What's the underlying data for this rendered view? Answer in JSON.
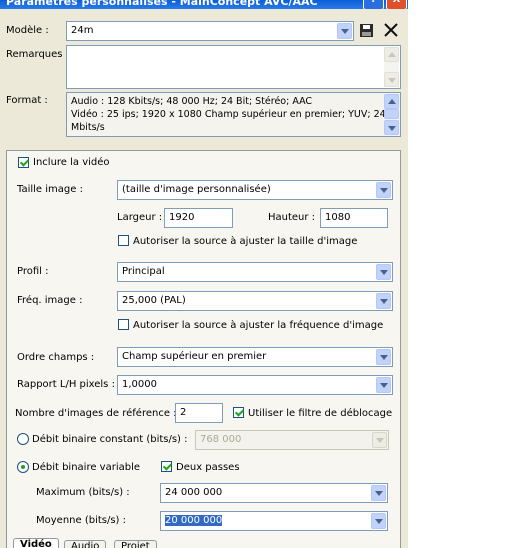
{
  "window": {
    "title": "Paramètres personnalisés - MainConcept AVC/AAC",
    "help_button": "?",
    "close_button": "X"
  },
  "modele": {
    "label": "Modèle :",
    "value": "24m"
  },
  "remarques": {
    "label": "Remarques :",
    "value": ""
  },
  "format": {
    "label": "Format :",
    "line1": "Audio : 128 Kbits/s; 48 000 Hz; 24 Bit; Stéréo; AAC",
    "line2": "Vidéo : 25 ips; 1920 x 1080 Champ supérieur en premier; YUV; 24",
    "line3": "Mbits/s"
  },
  "video": {
    "include_label": "Inclure la vidéo",
    "include_checked": true,
    "taille": {
      "label": "Taille image :",
      "value": "(taille d'image personnalisée)"
    },
    "largeur": {
      "label": "Largeur :",
      "value": "1920"
    },
    "hauteur": {
      "label": "Hauteur :",
      "value": "1080"
    },
    "auto_size": {
      "label": "Autoriser la source à ajuster la taille d'image",
      "checked": false
    },
    "profil": {
      "label": "Profil :",
      "value": "Principal"
    },
    "freq": {
      "label": "Fréq. image :",
      "value": "25,000 (PAL)"
    },
    "auto_freq": {
      "label": "Autoriser la source à ajuster la fréquence d'image",
      "checked": false
    },
    "ordre": {
      "label": "Ordre champs :",
      "value": "Champ supérieur en premier"
    },
    "rapport": {
      "label": "Rapport L/H pixels :",
      "value": "1,0000"
    },
    "ref_images": {
      "label": "Nombre d'images de référence :",
      "value": "2"
    },
    "deblock": {
      "label": "Utiliser le filtre de déblocage",
      "checked": true
    },
    "cbr": {
      "label": "Débit binaire constant (bits/s) :",
      "value": "768 000",
      "selected": false
    },
    "vbr": {
      "label": "Débit binaire variable",
      "selected": true
    },
    "two_pass": {
      "label": "Deux passes",
      "checked": true
    },
    "maximum": {
      "label": "Maximum (bits/s) :",
      "value": "24 000 000"
    },
    "moyenne": {
      "label": "Moyenne (bits/s) :",
      "value": "20 000 000"
    }
  },
  "tabs": [
    "Vidéo",
    "Audio",
    "Projet"
  ],
  "colors": {
    "titlebar": "#0a5fd8",
    "dialog_bg": "#ece9d8",
    "field_border": "#7f9db9",
    "check_green": "#21a121",
    "selection": "#316ac5"
  },
  "icons": [
    "save-icon",
    "delete-icon",
    "help-icon",
    "close-icon"
  ]
}
